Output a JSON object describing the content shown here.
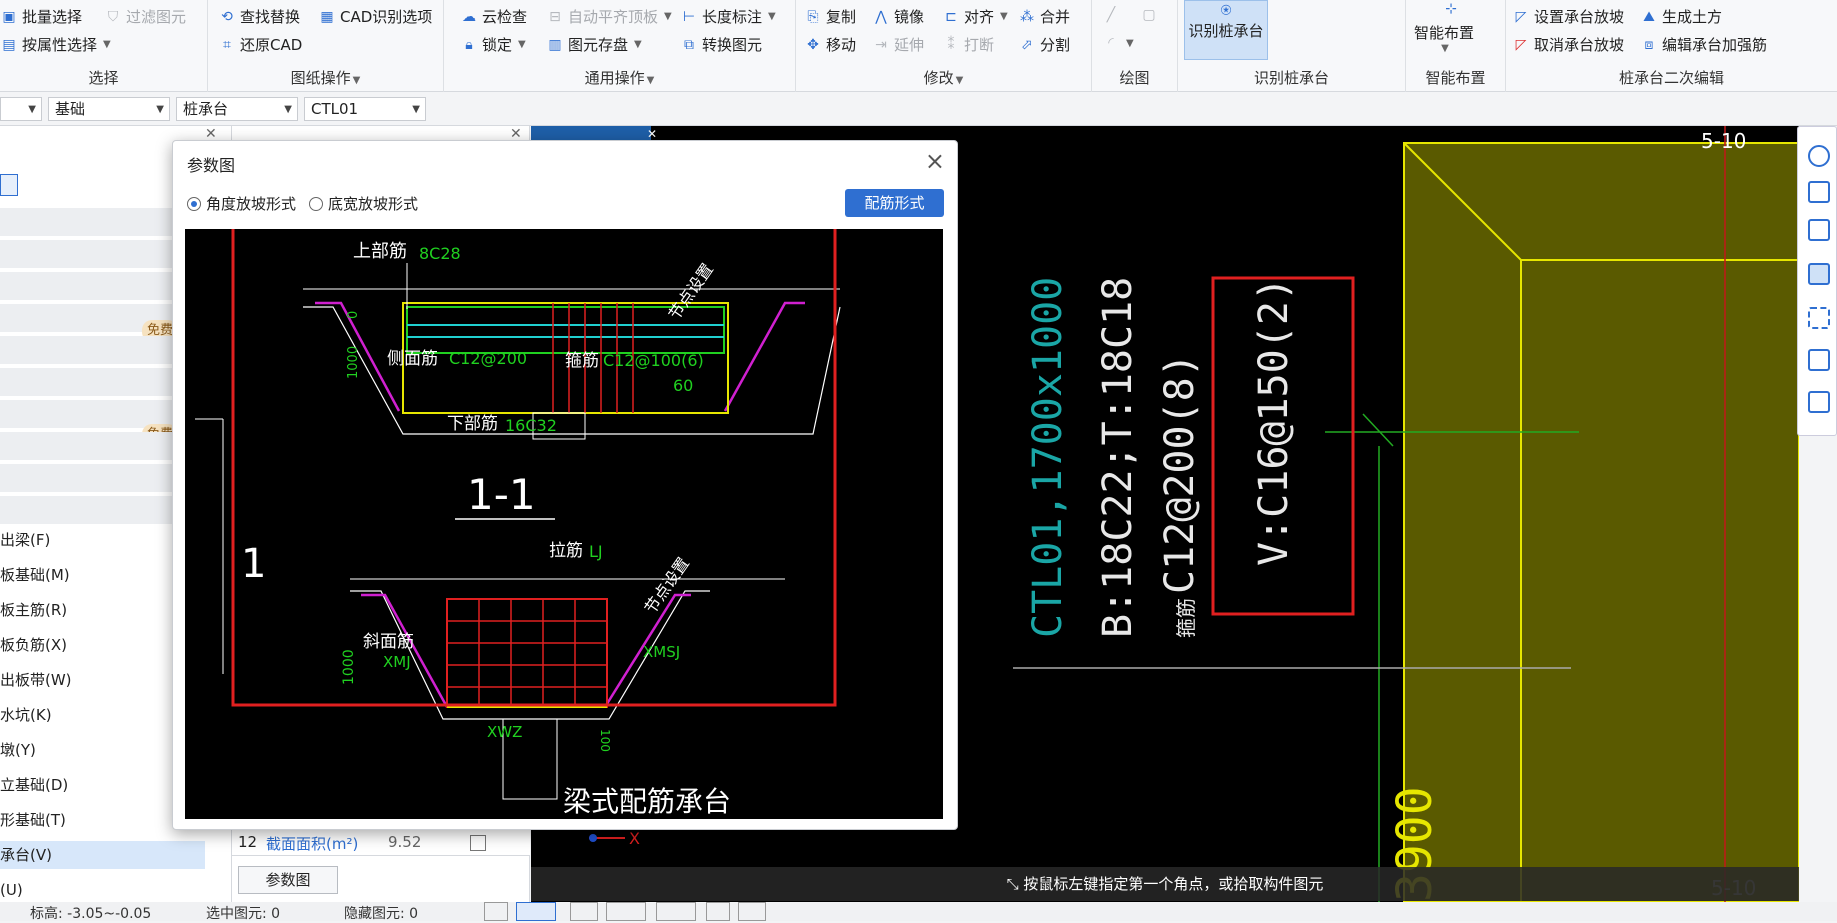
{
  "ribbon": {
    "select": {
      "title": "选择",
      "batch": "批量选择",
      "filter": "过滤图元",
      "by_attr": "按属性选择"
    },
    "drawing_ops": {
      "title": "图纸操作",
      "find_replace": "查找替换",
      "cad_options": "CAD识别选项",
      "restore_cad": "还原CAD"
    },
    "general_ops": {
      "title": "通用操作",
      "cloud_check": "云检查",
      "auto_level": "自动平齐顶板",
      "length_dim": "长度标注",
      "lock": "锁定",
      "elem_save": "图元存盘",
      "convert_elem": "转换图元"
    },
    "modify": {
      "title": "修改",
      "copy": "复制",
      "mirror": "镜像",
      "align": "对齐",
      "merge": "合并",
      "move": "移动",
      "extend": "延伸",
      "break": "打断",
      "split": "分割"
    },
    "draw": {
      "title": "绘图"
    },
    "recognize": {
      "title": "识别桩承台",
      "button": "识别桩承台"
    },
    "smart": {
      "title": "智能布置",
      "button": "智能布置"
    },
    "secondary": {
      "title": "桩承台二次编辑",
      "set_slope": "设置承台放坡",
      "gen_earth": "生成土方",
      "cancel_slope": "取消承台放坡",
      "edit_rebar": "编辑承台加强筋"
    }
  },
  "toolbar2": {
    "sel1": "",
    "sel2": "基础",
    "sel3": "桩承台",
    "sel4": "CTL01"
  },
  "left_panel": {
    "badge": "免费",
    "items": [
      "出梁(F)",
      "板基础(M)",
      "板主筋(R)",
      "板负筋(X)",
      "出板带(W)",
      "水坑(K)",
      "墩(Y)",
      "立基础(D)",
      "形基础(T)",
      "承台(V)",
      "(U)"
    ]
  },
  "props": {
    "row_no": "12",
    "row_name": "截面面积(m²)",
    "row_value": "9.52",
    "btn": "参数图"
  },
  "dialog": {
    "title": "参数图",
    "radio1": "角度放坡形式",
    "radio2": "底宽放坡形式",
    "rebar_btn": "配筋形式",
    "figure": {
      "top_rebar": "上部筋",
      "top_rebar_val": "8C28",
      "node": "节点设置",
      "side_rebar": "侧面筋",
      "side_rebar_val": "C12@200",
      "stirrup": "箍筋",
      "stirrup_val": "C12@100(6)",
      "angle": "60",
      "dim_a": "0",
      "dim_b": "1000",
      "bottom_rebar": "下部筋",
      "bottom_rebar_val": "16C32",
      "section": "1-1",
      "tie": "拉筋",
      "tie_val": "LJ",
      "node2": "节点设置",
      "slope_rebar": "斜面筋",
      "slope_val": "XMJ",
      "xmsj": "XMSJ",
      "xwz": "XWZ",
      "dim_c": "1000",
      "dim_d": "100",
      "left_num": "1",
      "caption": "梁式配筋承台"
    }
  },
  "canvas": {
    "tag_top": "5-10",
    "tag_bottom": "5-10",
    "text1": "CTL01,1700x1000",
    "text2": "B:18C22;T:18C18",
    "text3": "C12@200(8)",
    "text3_prefix": "箍筋",
    "text4": "V:C16@150(2)",
    "dim": "3900",
    "axis": "X",
    "status": "按鼠标左键指定第一个角点，或拾取构件图元"
  },
  "statusbar": {
    "elev": "标高: -3.05~-0.05",
    "selected": "选中图元: 0",
    "hidden": "隐藏图元: 0"
  },
  "colors": {
    "accent": "#2f6fd1",
    "green": "#00ff00",
    "yellow": "#e6e600",
    "cad_olive": "#5a5a00"
  }
}
